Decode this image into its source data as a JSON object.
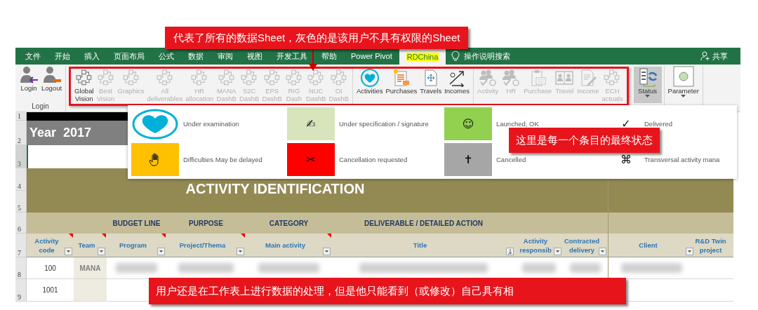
{
  "callouts": [
    {
      "kind": "top",
      "text": "代表了所有的数据Sheet，灰色的是该用户不具有权限的Sheet"
    },
    {
      "kind": "right",
      "text": "这里是每一个条目的最终状态"
    },
    {
      "kind": "bottom",
      "text": "用户还是在工作表上进行数据的处理，但是他只能看到（或修改）自己具有相"
    }
  ],
  "ribbon": {
    "tabs": [
      {
        "label": "文件",
        "selected": false
      },
      {
        "label": "开始",
        "selected": false
      },
      {
        "label": "插入",
        "selected": false
      },
      {
        "label": "页面布局",
        "selected": false
      },
      {
        "label": "公式",
        "selected": false
      },
      {
        "label": "数据",
        "selected": false
      },
      {
        "label": "审阅",
        "selected": false
      },
      {
        "label": "视图",
        "selected": false
      },
      {
        "label": "开发工具",
        "selected": false
      },
      {
        "label": "帮助",
        "selected": false
      },
      {
        "label": "Power Pivot",
        "selected": false
      },
      {
        "label": "RDChina",
        "selected": true
      }
    ],
    "search": "操作说明搜索",
    "share": "共享",
    "groups": [
      {
        "label": "Login",
        "outlined": false,
        "buttons": [
          {
            "label": "Login",
            "kind": "login",
            "disabled": false
          },
          {
            "label": "Logout",
            "kind": "logout",
            "disabled": false
          }
        ]
      },
      {
        "outlined": true,
        "buttons": [
          {
            "label": "Global\nVision",
            "kind": "sheet",
            "disabled": false
          },
          {
            "label": "Best\nVision",
            "kind": "sheet",
            "disabled": true
          },
          {
            "label": "Graphics",
            "kind": "sheet",
            "disabled": true
          },
          {
            "label": "All\ndeliverables",
            "kind": "sheet",
            "disabled": true
          },
          {
            "label": "HR\nallocation",
            "kind": "sheet",
            "disabled": true
          },
          {
            "label": "MANA\nDashB",
            "kind": "sheet",
            "disabled": true
          },
          {
            "label": "S2C\nDashB",
            "kind": "sheet",
            "disabled": true
          },
          {
            "label": "EPS\nDashB",
            "kind": "sheet",
            "disabled": true
          },
          {
            "label": "RIG\nDash",
            "kind": "sheet",
            "disabled": true
          },
          {
            "label": "NUC\nDashB",
            "kind": "sheet",
            "disabled": true
          },
          {
            "label": "OI\nDashB",
            "kind": "sheet",
            "disabled": true
          }
        ]
      },
      {
        "outlined": true,
        "buttons": [
          {
            "label": "Activities",
            "kind": "heart",
            "disabled": false
          },
          {
            "label": "Purchases",
            "kind": "document",
            "disabled": false
          },
          {
            "label": "Travels",
            "kind": "arrows",
            "disabled": false
          },
          {
            "label": "Incomes",
            "kind": "diagonal",
            "disabled": false
          }
        ]
      },
      {
        "outlined": true,
        "buttons": [
          {
            "label": "Activity",
            "kind": "users",
            "disabled": true
          },
          {
            "label": "HR",
            "kind": "users",
            "disabled": true
          },
          {
            "label": "Purchase",
            "kind": "clipboard",
            "disabled": true
          },
          {
            "label": "Travel",
            "kind": "book",
            "disabled": true
          },
          {
            "label": "Income",
            "kind": "note",
            "disabled": true
          },
          {
            "label": "ECH\nactuals",
            "kind": "sheet",
            "disabled": true
          }
        ]
      },
      {
        "outlined": false,
        "buttons": [
          {
            "label": "Status",
            "kind": "status",
            "disabled": false,
            "dropdown": true,
            "selected": true
          }
        ]
      },
      {
        "outlined": false,
        "buttons": [
          {
            "label": "Parameter",
            "kind": "parameter",
            "disabled": false,
            "dropdown": true,
            "selected": false
          }
        ]
      }
    ]
  },
  "legend": [
    {
      "kind": "ring",
      "label": "Under examination",
      "color": "#00b0d8"
    },
    {
      "kind": "swatch",
      "symbol": "✍",
      "label": "Under specification / signature",
      "color": "#d8e4bc"
    },
    {
      "kind": "swatch",
      "symbol": "☺",
      "label": "Launched, OK",
      "color": "#92d050"
    },
    {
      "kind": "plain",
      "symbol": "✓",
      "label": "Delivered"
    },
    {
      "kind": "swatch",
      "label": "Difficulties May be delayed",
      "color": "#ffc000"
    },
    {
      "kind": "swatch",
      "symbol": "✂",
      "label": "Cancellation requested",
      "color": "#ff0000"
    },
    {
      "kind": "swatch",
      "symbol": "✝",
      "label": "Cancelled",
      "color": "#a6a6a6"
    },
    {
      "kind": "plain",
      "symbol": "⌘",
      "label": "Transversal activity mana"
    }
  ],
  "sheet": {
    "year": "Year  2017",
    "banner": "ACTIVITY IDENTIFICATION",
    "row_numbers": [
      {
        "label": "1",
        "selected": false
      },
      {
        "label": "2",
        "selected": false
      },
      {
        "label": "3",
        "selected": true
      },
      {
        "label": "4",
        "selected": false
      },
      {
        "label": "5",
        "selected": false
      },
      {
        "label": "6",
        "selected": false
      },
      {
        "label": "7",
        "selected": false
      },
      {
        "label": "8",
        "selected": false
      },
      {
        "label": "9",
        "selected": false
      }
    ],
    "columns": [
      {
        "label": "Activity code",
        "note": true,
        "filter": true,
        "sorted": false
      },
      {
        "label": "Team",
        "note": true,
        "filter": true,
        "sorted": false
      },
      {
        "label": "Program",
        "band": "BUDGET LINE",
        "note": true,
        "filter": true,
        "sorted": false
      },
      {
        "label": "Project/Thema",
        "band": "PURPOSE",
        "note": true,
        "filter": true,
        "sorted": false
      },
      {
        "label": "Main activity",
        "band": "CATEGORY",
        "note": true,
        "filter": true,
        "sorted": false
      },
      {
        "label": "Title",
        "band": "DELIVERABLE / DETAILED ACTION",
        "note": false,
        "filter": true,
        "sorted": true
      },
      {
        "label": "Activity\nresponsib",
        "note": false,
        "filter": true,
        "sorted": false
      },
      {
        "label": "Contracted\ndelivery",
        "note": false,
        "filter": true,
        "sorted": false
      },
      {
        "label": "Client",
        "note": false,
        "filter": true,
        "sorted": false
      },
      {
        "label": "R&D Twin\nproject",
        "note": false,
        "filter": false
      }
    ],
    "rows": [
      {
        "cells": [
          {
            "kind": "text",
            "text": "100"
          },
          {
            "kind": "text",
            "text": "MANA",
            "shaded": true
          },
          {
            "kind": "blurred"
          },
          {
            "kind": "blurred"
          },
          {
            "kind": "blurred"
          },
          {
            "kind": "blurred"
          },
          {
            "kind": "blurred"
          },
          {
            "kind": "blurred"
          },
          {
            "kind": "blurred"
          },
          {
            "kind": "empty"
          }
        ]
      },
      {
        "cells": [
          {
            "kind": "text",
            "text": "1001"
          },
          {
            "kind": "empty",
            "shaded": true
          },
          {
            "kind": "empty"
          },
          {
            "kind": "empty"
          },
          {
            "kind": "empty"
          },
          {
            "kind": "empty"
          },
          {
            "kind": "empty"
          },
          {
            "kind": "empty"
          },
          {
            "kind": "empty"
          },
          {
            "kind": "empty"
          }
        ]
      }
    ]
  }
}
